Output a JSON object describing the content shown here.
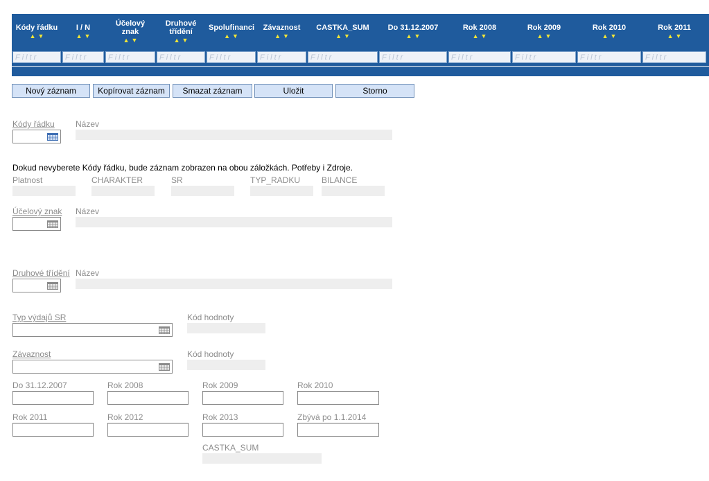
{
  "grid": {
    "columns": [
      {
        "key": "kody_radku",
        "label": "Kódy řádku"
      },
      {
        "key": "i_n",
        "label": "I / N"
      },
      {
        "key": "ucelovy_znak",
        "label": "Účelový znak"
      },
      {
        "key": "druhove_trideni",
        "label": "Druhové třídění"
      },
      {
        "key": "spolufinanci",
        "label": "Spolufinanci"
      },
      {
        "key": "zavaznost",
        "label": "Závaznost"
      },
      {
        "key": "castka_sum",
        "label": "CASTKA_SUM"
      },
      {
        "key": "do_2007",
        "label": "Do 31.12.2007"
      },
      {
        "key": "rok_2008",
        "label": "Rok 2008"
      },
      {
        "key": "rok_2009",
        "label": "Rok 2009"
      },
      {
        "key": "rok_2010",
        "label": "Rok 2010"
      },
      {
        "key": "rok_2011",
        "label": "Rok 2011"
      }
    ],
    "column_lines": {
      "ucelovy_znak": [
        "Účelový",
        "znak"
      ],
      "druhove_trideni": [
        "Druhové",
        "třídění"
      ]
    },
    "filter_placeholder": "Filtr",
    "sort_up": "▲",
    "sort_down": "▼"
  },
  "toolbar": {
    "new_label": "Nový záznam",
    "copy_label": "Kopírovat záznam",
    "delete_label": "Smazat záznam",
    "save_label": "Uložit",
    "cancel_label": "Storno"
  },
  "form": {
    "kody_radku_label": "Kódy řádku",
    "nazev_label": "Název",
    "info_text": "Dokud nevyberete Kódy řádku, bude záznam zobrazen na obou záložkách. Potřeby i Zdroje.",
    "platnost_label": "Platnost",
    "charakter_label": "CHARAKTER",
    "sr_label": "SR",
    "typ_radku_label": "TYP_RADKU",
    "bilance_label": "BILANCE",
    "ucelovy_znak_label": "Účelový znak",
    "druhove_trideni_label": "Druhové třídění",
    "typ_vydaju_label": "Typ výdajů SR",
    "kod_hodnoty_label": "Kód hodnoty",
    "zavaznost_label": "Závaznost",
    "do_2007_label": "Do 31.12.2007",
    "rok_2008_label": "Rok 2008",
    "rok_2009_label": "Rok 2009",
    "rok_2010_label": "Rok 2010",
    "rok_2011_label": "Rok 2011",
    "rok_2012_label": "Rok 2012",
    "rok_2013_label": "Rok 2013",
    "zbyva_label": "Zbývá po 1.1.2014",
    "castka_sum_label": "CASTKA_SUM"
  },
  "colors": {
    "header_bg": "#1f5b9d",
    "sort_arrow": "#f2e536",
    "button_bg": "#d5e3f7",
    "readonly_bg": "#eeeeee"
  }
}
